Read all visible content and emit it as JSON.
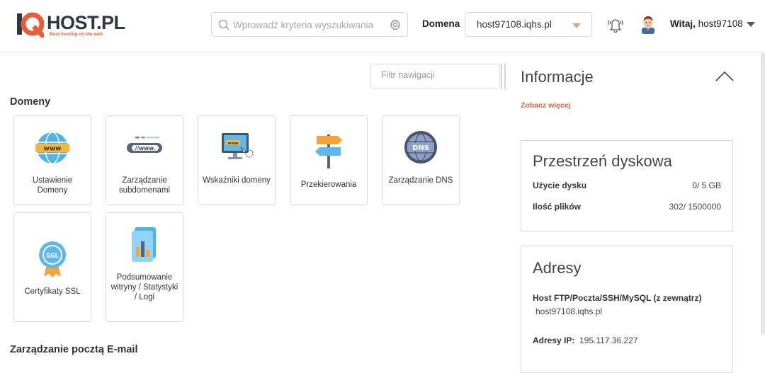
{
  "header": {
    "logo_text": "HOST.PL",
    "logo_tagline": "Best hosting on the web",
    "search_placeholder": "Wprowadź kryteria wyszukiwania",
    "domain_label": "Domena",
    "domain_value": "host97108.iqhs.pl",
    "greeting_bold": "Witaj,",
    "username": "host97108"
  },
  "main": {
    "nav_filter_placeholder": "Filtr nawigacji",
    "sections": [
      {
        "title": "Domeny",
        "tiles": [
          {
            "label": "Ustawienie Domeny",
            "icon": "www-globe-icon"
          },
          {
            "label": "Zarządzanie subdomenami",
            "icon": "www-address-bar-icon"
          },
          {
            "label": "Wskaźniki domeny",
            "icon": "monitor-www-icon"
          },
          {
            "label": "Przekierowania",
            "icon": "signpost-icon"
          },
          {
            "label": "Zarządzanie DNS",
            "icon": "dns-globe-icon"
          },
          {
            "label": "Certyfikaty SSL",
            "icon": "ssl-badge-icon"
          },
          {
            "label": "Podsumowanie witryny / Statystyki / Logi",
            "icon": "statistics-chart-icon"
          }
        ]
      },
      {
        "title": "Zarządzanie pocztą E-mail"
      }
    ]
  },
  "info": {
    "title": "Informacje",
    "see_more": "Zobacz więcej",
    "disk": {
      "title": "Przestrzeń dyskowa",
      "rows": [
        {
          "label": "Użycie dysku",
          "value": "0/ 5 GB"
        },
        {
          "label": "Ilość plików",
          "value": "302/ 1500000"
        }
      ]
    },
    "addresses": {
      "title": "Adresy",
      "host_label": "Host FTP/Poczta/SSH/MySQL (z zewnątrz)",
      "host_value": "host97108.iqhs.pl",
      "ip_label": "Adresy IP:",
      "ip_value": "195.117.36.227"
    }
  },
  "colors": {
    "accent": "#e85c3a",
    "border": "#dadada",
    "text": "#333333"
  }
}
